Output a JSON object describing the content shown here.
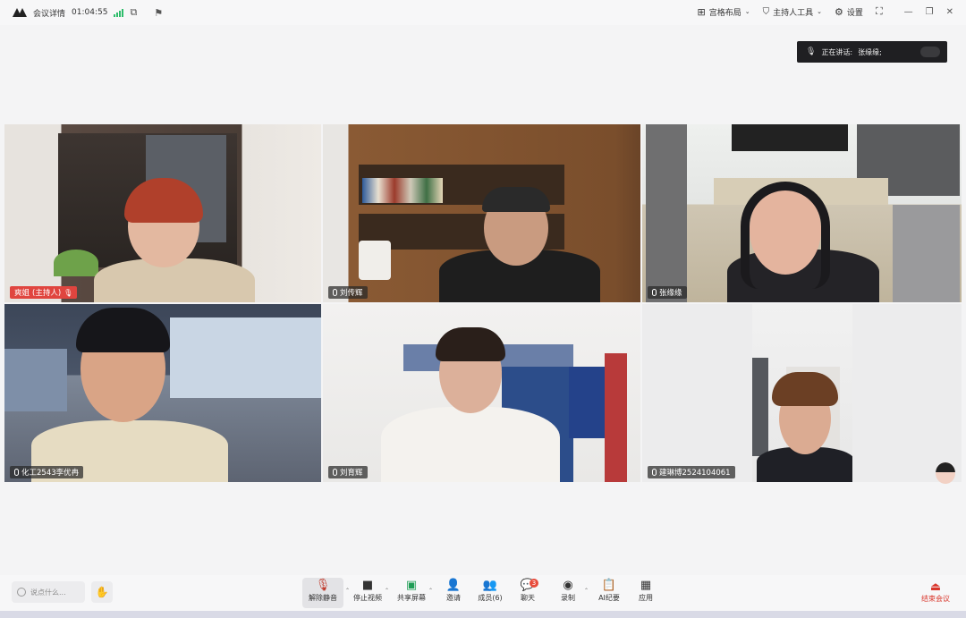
{
  "titlebar": {
    "meeting_details": "会议详情",
    "elapsed": "01:04:55",
    "layout_label": "宫格布局",
    "host_tools_label": "主持人工具",
    "settings_label": "设置"
  },
  "speaking": {
    "label": "正在讲话:",
    "name": "张缘缘;"
  },
  "participants": [
    {
      "name": "爽姐",
      "role": "(主持人)"
    },
    {
      "name": "刘传辉"
    },
    {
      "name": "张缘缘"
    },
    {
      "name": "化工2543李优冉"
    },
    {
      "name": "刘育辉"
    },
    {
      "name": "建琳博2524104061"
    }
  ],
  "toolbar": {
    "chat_placeholder": "说点什么...",
    "buttons": [
      {
        "label": "解除静音",
        "icon": "mic-muted-icon"
      },
      {
        "label": "停止视频",
        "icon": "video-camera-icon"
      },
      {
        "label": "共享屏幕",
        "icon": "share-screen-icon"
      },
      {
        "label": "邀请",
        "icon": "invite-icon"
      },
      {
        "label": "成员(6)",
        "icon": "members-icon"
      },
      {
        "label": "聊天",
        "icon": "chat-icon",
        "badge": "3"
      },
      {
        "label": "录制",
        "icon": "record-icon"
      },
      {
        "label": "AI纪要",
        "icon": "ai-minutes-icon"
      },
      {
        "label": "应用",
        "icon": "apps-icon"
      }
    ],
    "end_label": "结束会议"
  },
  "colors": {
    "active_speaker_border": "#2fc38a",
    "host_tag": "#e0453f",
    "end_meeting": "#d9362b"
  }
}
